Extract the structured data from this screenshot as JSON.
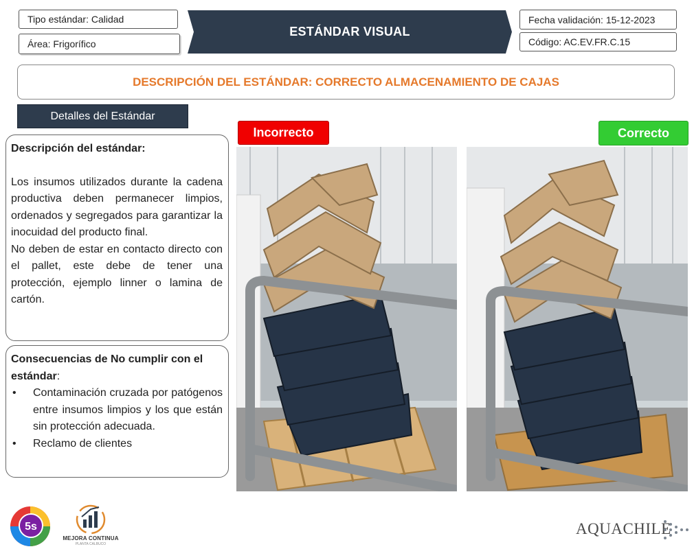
{
  "header": {
    "tipo": "Tipo estándar: Calidad",
    "area": "Área: Frigorífico",
    "title": "ESTÁNDAR VISUAL",
    "fecha": "Fecha validación: 15-12-2023",
    "codigo": "Código: AC.EV.FR.C.15"
  },
  "description_bar": "DESCRIPCIÓN DEL ESTÁNDAR: CORRECTO ALMACENAMIENTO DE CAJAS",
  "details_header": "Detalles del Estándar",
  "description_panel": {
    "heading": "Descripción del estándar:",
    "paragraph1": "Los insumos utilizados durante la cadena productiva deben permanecer limpios, ordenados y segregados para garantizar la inocuidad del producto final.",
    "paragraph2": "No deben de estar en contacto directo con el pallet, este debe de tener una protección, ejemplo linner o lamina de cartón."
  },
  "consequences_panel": {
    "heading": "Consecuencias de No cumplir con el estándar",
    "heading_suffix": ":",
    "bullet_char": "•",
    "items": [
      "Contaminación cruzada por patógenos entre insumos limpios y los que están sin protección adecuada.",
      "Reclamo de clientes"
    ]
  },
  "tags": {
    "incorrect": "Incorrecto",
    "correct": "Correcto"
  },
  "colors": {
    "banner": "#2e3c4d",
    "accent_orange": "#e5792b",
    "incorrect_red": "#f00000",
    "correct_green": "#33cc33"
  },
  "footer": {
    "logo_5s": "5s",
    "mejora_title": "MEJORA CONTINUA",
    "mejora_subtitle": "PLANTA CALBUCO",
    "brand": "AQUACHILE"
  }
}
